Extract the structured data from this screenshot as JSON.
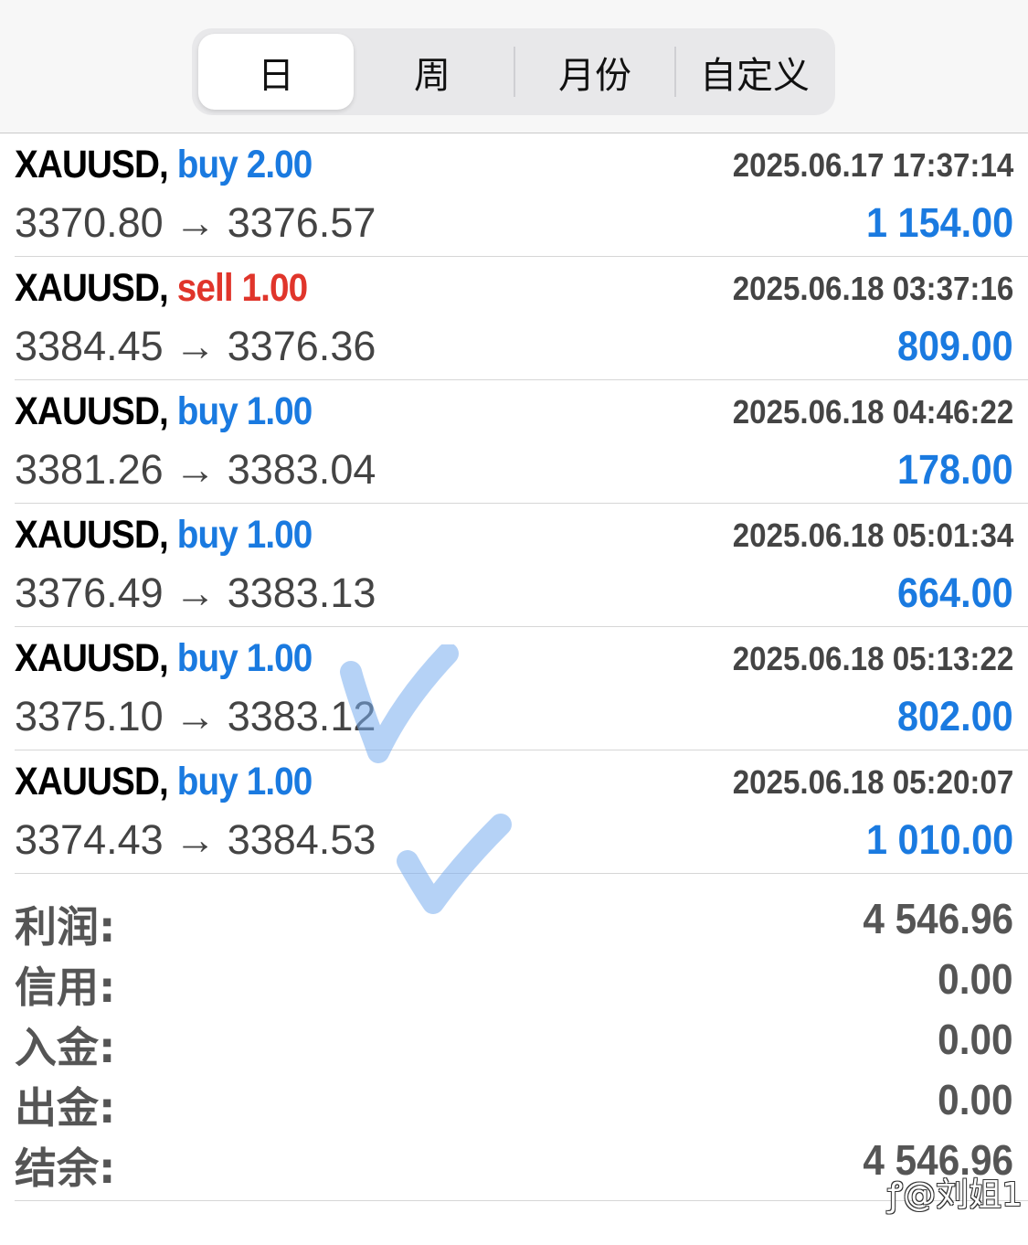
{
  "tabs": [
    {
      "label": "日",
      "active": true
    },
    {
      "label": "周",
      "active": false
    },
    {
      "label": "月份",
      "active": false
    },
    {
      "label": "自定义",
      "active": false
    }
  ],
  "deals": [
    {
      "symbol": "XAUUSD,",
      "side": "buy",
      "volume": "2.00",
      "time": "2025.06.17 17:37:14",
      "open": "3370.80",
      "arrow": "→",
      "close": "3376.57",
      "profit": "1 154.00"
    },
    {
      "symbol": "XAUUSD,",
      "side": "sell",
      "volume": "1.00",
      "time": "2025.06.18 03:37:16",
      "open": "3384.45",
      "arrow": "→",
      "close": "3376.36",
      "profit": "809.00"
    },
    {
      "symbol": "XAUUSD,",
      "side": "buy",
      "volume": "1.00",
      "time": "2025.06.18 04:46:22",
      "open": "3381.26",
      "arrow": "→",
      "close": "3383.04",
      "profit": "178.00"
    },
    {
      "symbol": "XAUUSD,",
      "side": "buy",
      "volume": "1.00",
      "time": "2025.06.18 05:01:34",
      "open": "3376.49",
      "arrow": "→",
      "close": "3383.13",
      "profit": "664.00"
    },
    {
      "symbol": "XAUUSD,",
      "side": "buy",
      "volume": "1.00",
      "time": "2025.06.18 05:13:22",
      "open": "3375.10",
      "arrow": "→",
      "close": "3383.12",
      "profit": "802.00"
    },
    {
      "symbol": "XAUUSD,",
      "side": "buy",
      "volume": "1.00",
      "time": "2025.06.18 05:20:07",
      "open": "3374.43",
      "arrow": "→",
      "close": "3384.53",
      "profit": "1 010.00"
    }
  ],
  "summary": [
    {
      "label": "利润:",
      "value": "4 546.96"
    },
    {
      "label": "信用:",
      "value": "0.00"
    },
    {
      "label": "入金:",
      "value": "0.00"
    },
    {
      "label": "出金:",
      "value": "0.00"
    },
    {
      "label": "结余:",
      "value": "4 546.96"
    }
  ],
  "watermark": "@刘姐1",
  "colors": {
    "buy": "#1a7ae0",
    "sell": "#e0352b",
    "profit": "#1a7ae0",
    "muted": "#555555"
  }
}
